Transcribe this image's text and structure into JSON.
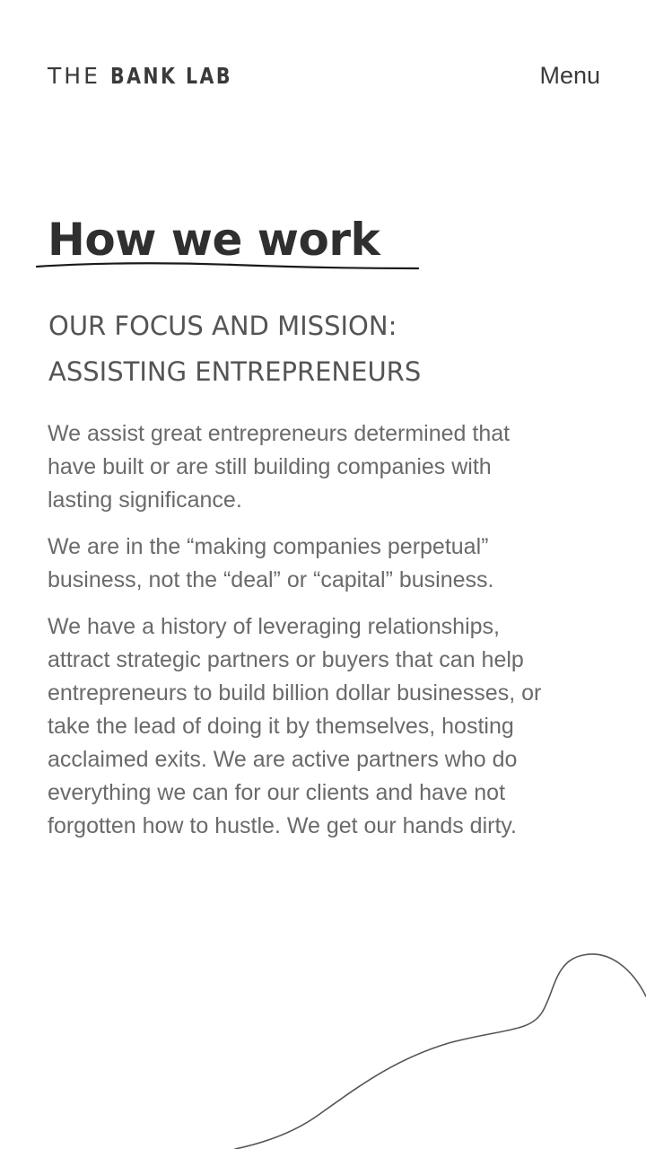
{
  "header": {
    "logo_light": "THE",
    "logo_bold": "BANK LAB",
    "menu_label": "Menu"
  },
  "main": {
    "title": "How we work",
    "subtitle_line1": "OUR FOCUS AND MISSION:",
    "subtitle_line2": "ASSISTING ENTREPRENEURS",
    "paragraphs": [
      "We assist great entrepreneurs determined that have built or are still building companies with lasting significance.",
      "We are in the “making companies perpetual” business, not the “deal” or “capital” business.",
      "We have a history of leveraging relationships, attract strategic partners or buyers that can help entrepreneurs to build billion dollar businesses, or take the lead of doing it by themselves, hosting acclaimed exits. We are active partners who do everything we can for our clients and have not forgotten how to hustle. We get our hands dirty."
    ]
  },
  "colors": {
    "background": "#ffffff",
    "heading": "#2f2f2f",
    "body_text": "#6a6a6a",
    "subtitle": "#555555"
  },
  "icons": {
    "underline": "hand-drawn-underline",
    "decoration": "curved-line-decoration"
  }
}
